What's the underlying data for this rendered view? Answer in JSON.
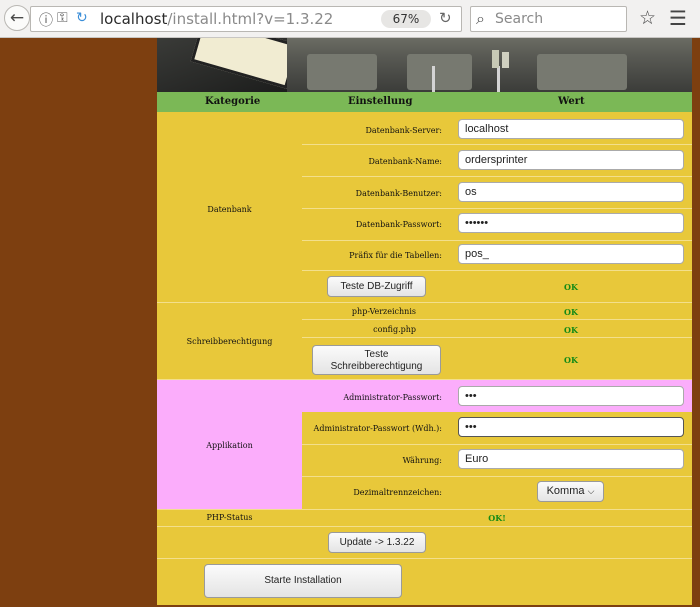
{
  "browser": {
    "back_icon": "back-arrow-icon",
    "url_host": "localhost",
    "url_path": "/install.html?v=1.3.22",
    "zoom": "67%",
    "search_placeholder": "Search"
  },
  "table": {
    "headers": {
      "category": "Kategorie",
      "setting": "Einstellung",
      "value": "Wert"
    },
    "database": {
      "category": "Datenbank",
      "server_label": "Datenbank-Server:",
      "server_value": "localhost",
      "name_label": "Datenbank-Name:",
      "name_value": "ordersprinter",
      "user_label": "Datenbank-Benutzer:",
      "user_value": "os",
      "password_label": "Datenbank-Passwort:",
      "password_value": "••••••",
      "prefix_label": "Präfix für die Tabellen:",
      "prefix_value": "pos_",
      "test_button": "Teste DB-Zugriff",
      "test_status": "OK"
    },
    "permissions": {
      "category": "Schreibberechtigung",
      "php_dir_label": "php-Verzeichnis",
      "php_dir_status": "OK",
      "config_label": "config.php",
      "config_status": "OK",
      "test_button_line1": "Teste",
      "test_button_line2": "Schreibberechtigung",
      "test_status": "OK"
    },
    "application": {
      "category": "Applikation",
      "admin_pw_label": "Administrator-Passwort:",
      "admin_pw_value": "•••",
      "admin_pw2_label": "Administrator-Passwort (Wdh.):",
      "admin_pw2_value": "•••",
      "currency_label": "Währung:",
      "currency_value": "Euro",
      "decimal_label": "Dezimaltrennzeichen:",
      "decimal_value": "Komma"
    },
    "php_status": {
      "label": "PHP-Status",
      "value": "OK!"
    },
    "update_button": "Update -> 1.3.22",
    "install_button": "Starte Installation"
  }
}
